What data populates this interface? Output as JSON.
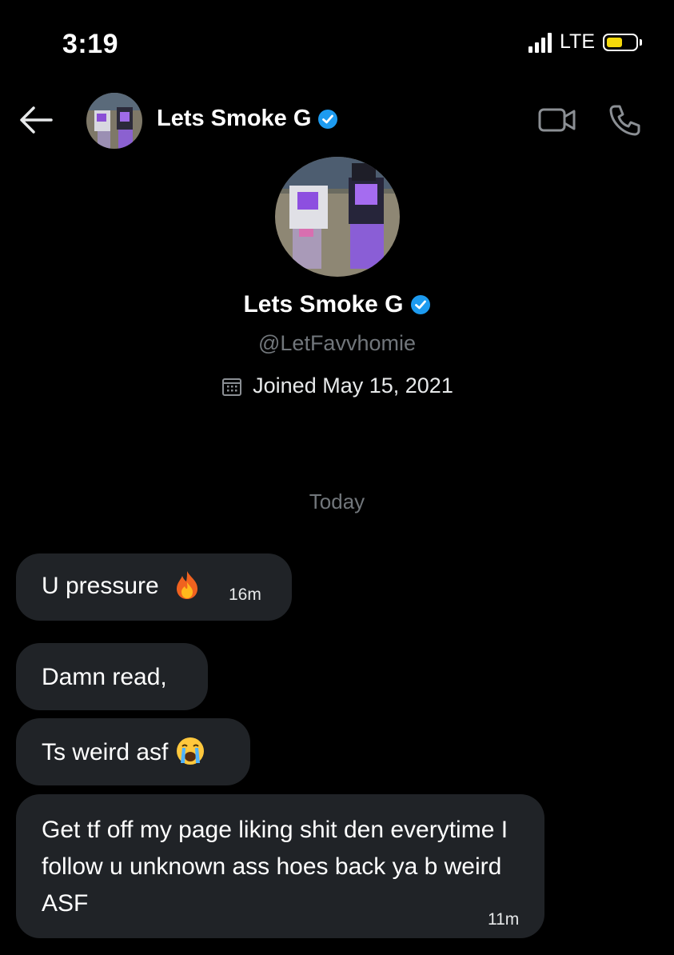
{
  "status_bar": {
    "time": "3:19",
    "network": "LTE",
    "signal_bars": 4,
    "battery_color": "#f5d90a",
    "battery_level": 0.55
  },
  "header": {
    "name": "Lets Smoke G",
    "verified": true,
    "back_icon": "arrow-left-icon",
    "video_icon": "video-camera-icon",
    "phone_icon": "phone-icon"
  },
  "profile": {
    "name": "Lets Smoke G",
    "handle": "@LetFavvhomie",
    "joined": "Joined May 15, 2021",
    "joined_icon": "calendar-icon"
  },
  "conversation": {
    "date_separator": "Today",
    "messages": [
      {
        "text": "U pressure",
        "emoji": "fire",
        "time": "16m"
      },
      {
        "text": "Damn read,",
        "time": ""
      },
      {
        "text": "Ts weird asf",
        "emoji": "loudly-crying-face",
        "time": ""
      },
      {
        "text": "Get tf off my page liking shit den everytime I follow u unknown ass hoes back ya b weird ASF",
        "time": "11m"
      }
    ]
  },
  "colors": {
    "background": "#000000",
    "bubble": "#202327",
    "muted_text": "#71767b",
    "verified_blue": "#1d9bf0"
  }
}
